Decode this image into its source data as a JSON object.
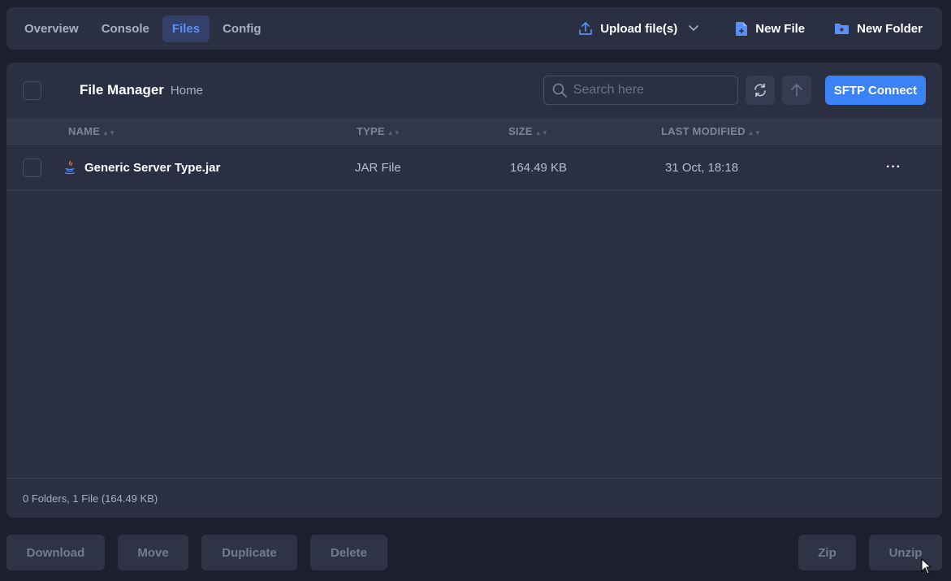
{
  "tabs": [
    {
      "label": "Overview",
      "active": false
    },
    {
      "label": "Console",
      "active": false
    },
    {
      "label": "Files",
      "active": true
    },
    {
      "label": "Config",
      "active": false
    }
  ],
  "top_actions": {
    "upload_label": "Upload file(s)",
    "new_file_label": "New File",
    "new_folder_label": "New Folder"
  },
  "file_manager": {
    "title": "File Manager",
    "breadcrumb": "Home",
    "search_placeholder": "Search here",
    "sftp_label": "SFTP Connect"
  },
  "columns": {
    "name": "NAME",
    "type": "TYPE",
    "size": "SIZE",
    "modified": "LAST MODIFIED"
  },
  "files": [
    {
      "name": "Generic Server Type.jar",
      "type": "JAR File",
      "size": "164.49 KB",
      "modified": "31 Oct, 18:18",
      "icon": "java-icon"
    }
  ],
  "summary": "0 Folders, 1 File (164.49 KB)",
  "bottom_actions": {
    "download": "Download",
    "move": "Move",
    "duplicate": "Duplicate",
    "delete": "Delete",
    "zip": "Zip",
    "unzip": "Unzip"
  },
  "colors": {
    "accent": "#3b82f6",
    "active_tab_text": "#5b8ff7",
    "panel": "#2a2f42",
    "background": "#1b1f2e"
  }
}
